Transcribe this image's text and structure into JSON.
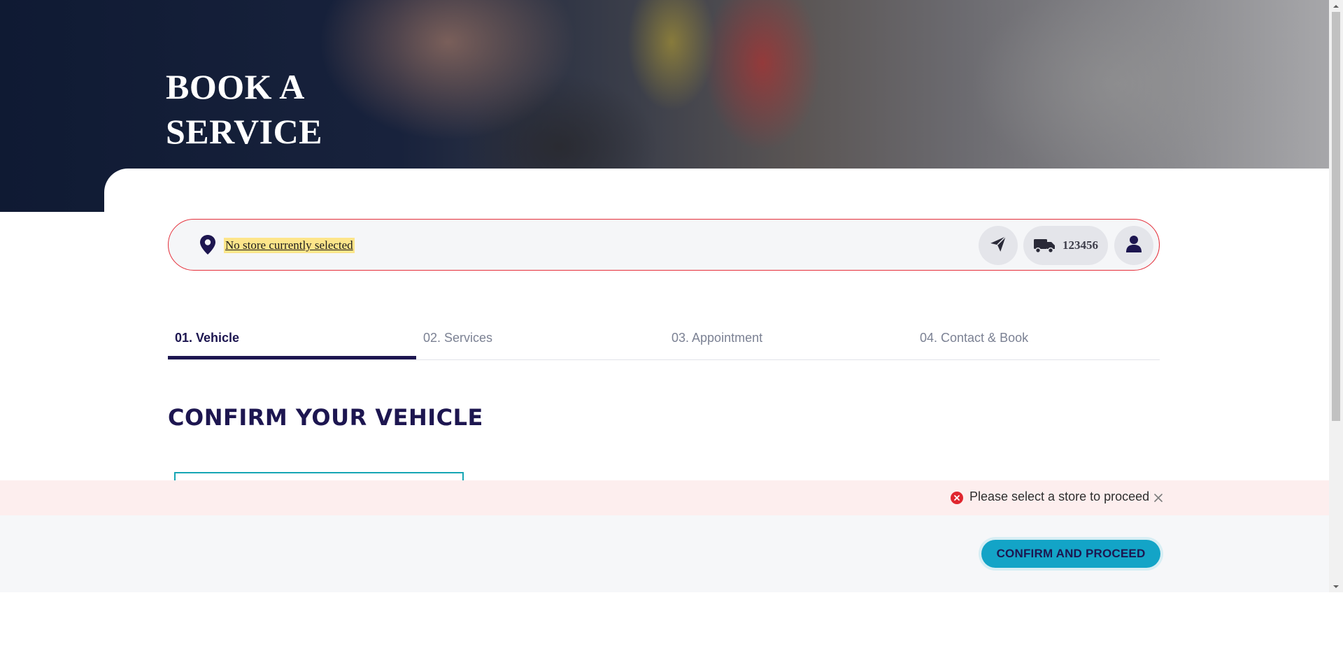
{
  "hero": {
    "title": "BOOK A SERVICE"
  },
  "store_bar": {
    "store_text": "No store currently selected",
    "vehicle_count": "123456",
    "icons": [
      "location-pin-icon",
      "paper-plane-icon",
      "truck-icon",
      "user-icon"
    ]
  },
  "tabs": [
    {
      "label": "01. Vehicle",
      "active": true
    },
    {
      "label": "02. Services",
      "active": false
    },
    {
      "label": "03. Appointment",
      "active": false
    },
    {
      "label": "04. Contact & Book",
      "active": false
    }
  ],
  "main": {
    "section_title": "CONFIRM YOUR VEHICLE"
  },
  "alert": {
    "message": "Please select a store to proceed",
    "icon": "error-circle-icon"
  },
  "footer": {
    "confirm_label": "CONFIRM AND PROCEED"
  },
  "colors": {
    "brand_navy": "#1d1650",
    "accent_cyan": "#13a4c7",
    "error_red": "#e0262f",
    "alert_bg": "#fdeeee",
    "highlight_yellow": "#fde58a"
  }
}
